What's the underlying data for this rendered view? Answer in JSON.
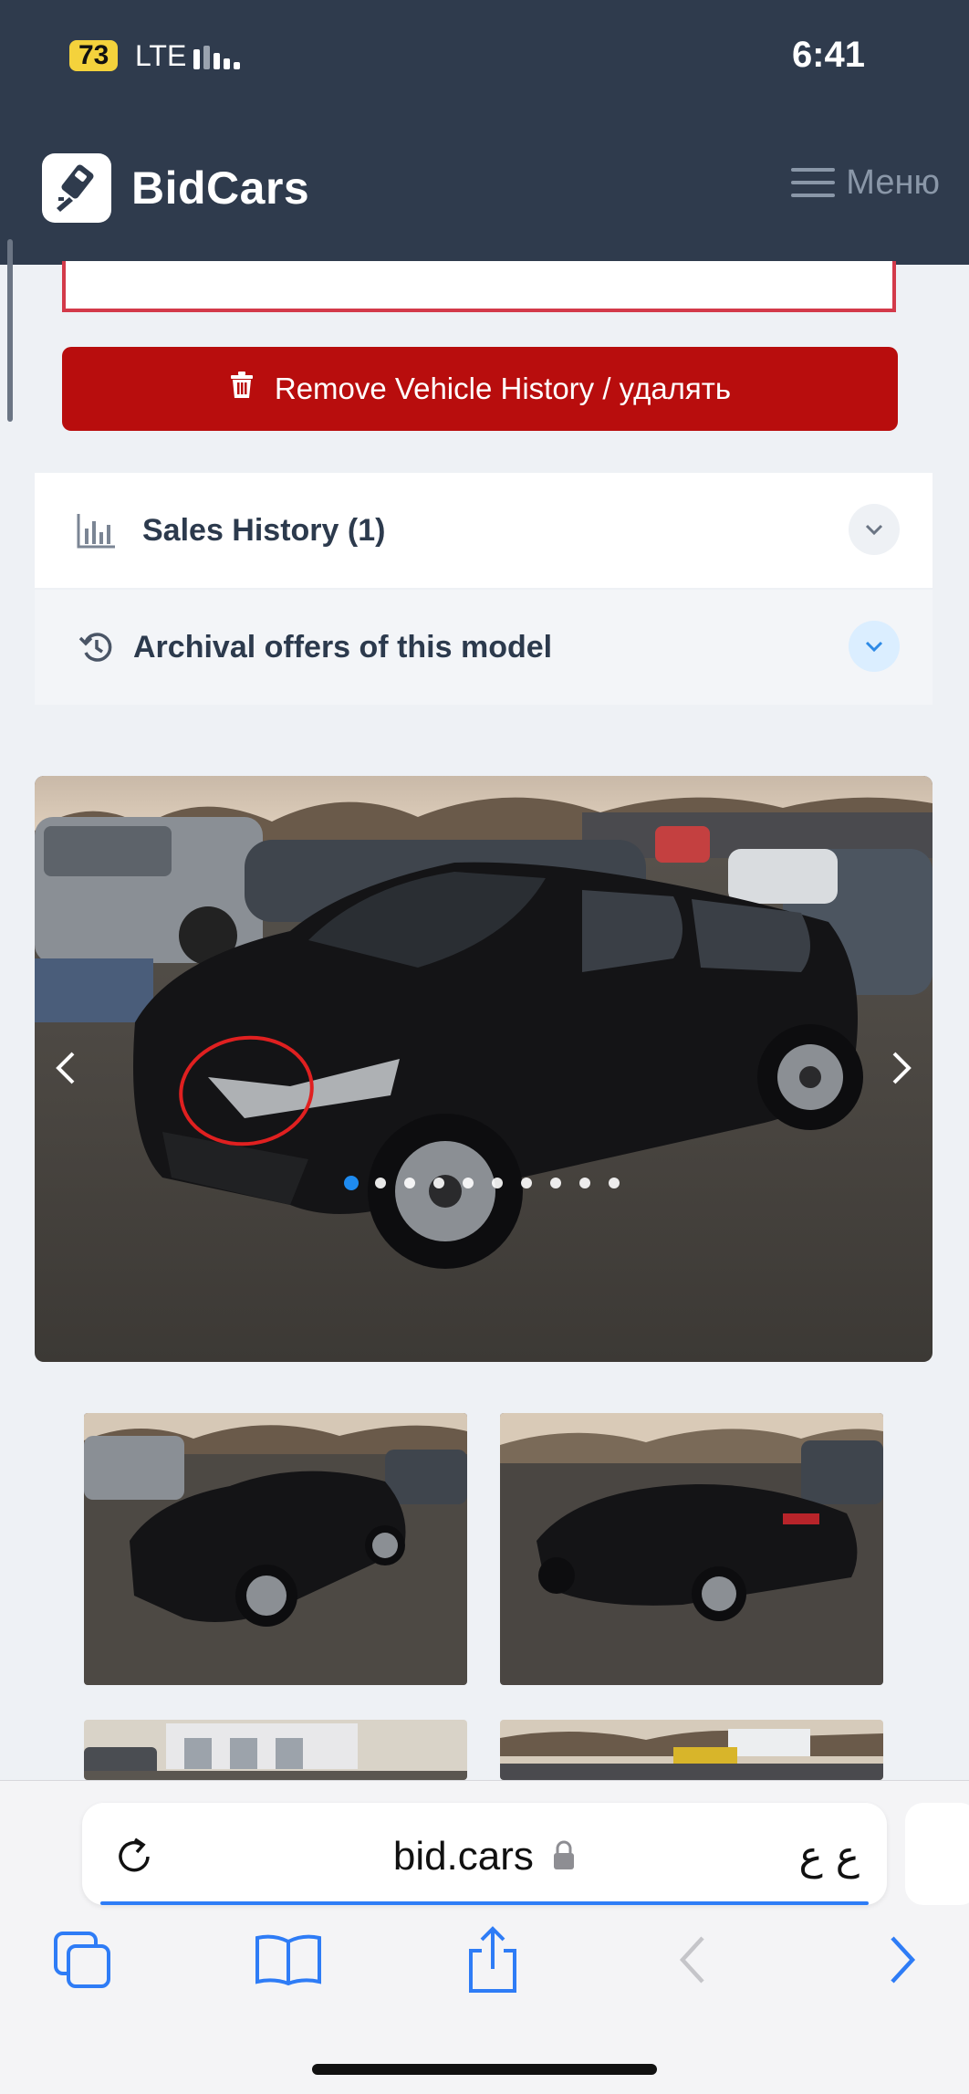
{
  "status_bar": {
    "battery": "73",
    "network": "LTE",
    "time": "6:41"
  },
  "header": {
    "brand": "BidCars",
    "menu_label": "Меню"
  },
  "actions": {
    "remove_history_label": "Remove Vehicle History / удалять"
  },
  "sections": {
    "sales_history_label": "Sales History (1)",
    "archival_offers_label": "Archival offers of this model"
  },
  "gallery": {
    "slide_count": 10,
    "active_slide": 1,
    "image_subject": "black sedan with front-end damage in a salvage lot"
  },
  "browser": {
    "url": "bid.cars",
    "url_extra": "ع ع",
    "accent_color": "#2e7cf6"
  },
  "colors": {
    "header_bg": "#2f3b4d",
    "danger": "#b80d0d",
    "danger_border": "#d33a4a",
    "page_bg": "#eef1f5"
  }
}
